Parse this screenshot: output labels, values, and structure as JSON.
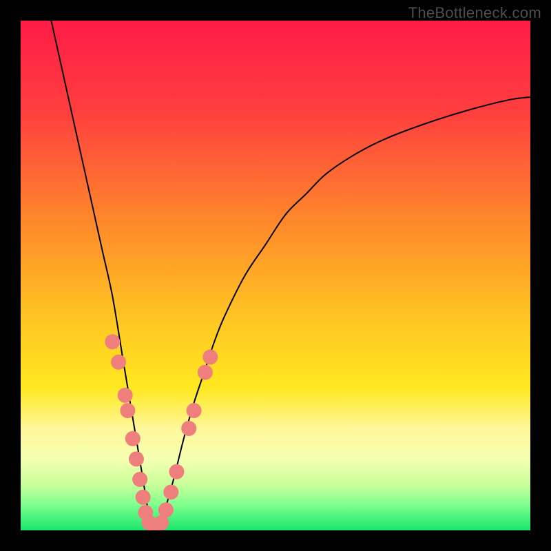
{
  "watermark": "TheBottleneck.com",
  "chart_data": {
    "type": "line",
    "title": "",
    "xlabel": "",
    "ylabel": "",
    "xlim": [
      0,
      100
    ],
    "ylim": [
      0,
      100
    ],
    "background_gradient": {
      "stops": [
        {
          "offset": 0.0,
          "color": "#ff1b46"
        },
        {
          "offset": 0.18,
          "color": "#ff3f3f"
        },
        {
          "offset": 0.4,
          "color": "#ff8a2a"
        },
        {
          "offset": 0.58,
          "color": "#ffc423"
        },
        {
          "offset": 0.72,
          "color": "#ffe81f"
        },
        {
          "offset": 0.8,
          "color": "#fff79a"
        },
        {
          "offset": 0.86,
          "color": "#f6ffb0"
        },
        {
          "offset": 0.91,
          "color": "#c9ff9a"
        },
        {
          "offset": 0.95,
          "color": "#7fff8e"
        },
        {
          "offset": 1.0,
          "color": "#18e76c"
        }
      ]
    },
    "series": [
      {
        "name": "bottleneck-curve",
        "color": "#000000",
        "stroke_width": 2,
        "x": [
          6,
          8,
          10,
          12,
          14,
          16,
          18,
          20,
          21,
          22,
          23,
          24,
          25,
          26,
          27,
          28,
          30,
          32,
          34,
          36,
          38,
          40,
          44,
          48,
          52,
          56,
          60,
          66,
          72,
          80,
          88,
          96,
          100
        ],
        "y": [
          100,
          91,
          82,
          73,
          64,
          55,
          46,
          34,
          28,
          22,
          16,
          10,
          4,
          0,
          0,
          3,
          10,
          18,
          25,
          31,
          37,
          42,
          50,
          56,
          62,
          66,
          70,
          74,
          77,
          80,
          82.5,
          84.5,
          85
        ]
      }
    ],
    "markers": {
      "name": "highlight-points",
      "color": "#ef7f7c",
      "radius": 11,
      "points": [
        {
          "x": 18.0,
          "y": 37.0
        },
        {
          "x": 19.2,
          "y": 33.0
        },
        {
          "x": 20.5,
          "y": 26.5
        },
        {
          "x": 21.0,
          "y": 23.5
        },
        {
          "x": 22.0,
          "y": 18.0
        },
        {
          "x": 22.7,
          "y": 14.0
        },
        {
          "x": 23.4,
          "y": 10.0
        },
        {
          "x": 24.0,
          "y": 6.5
        },
        {
          "x": 24.5,
          "y": 3.5
        },
        {
          "x": 25.2,
          "y": 1.5
        },
        {
          "x": 26.0,
          "y": 0.5
        },
        {
          "x": 26.8,
          "y": 0.5
        },
        {
          "x": 27.6,
          "y": 1.5
        },
        {
          "x": 28.5,
          "y": 4.0
        },
        {
          "x": 29.5,
          "y": 7.5
        },
        {
          "x": 30.6,
          "y": 11.5
        },
        {
          "x": 33.0,
          "y": 20.0
        },
        {
          "x": 34.0,
          "y": 23.5
        },
        {
          "x": 36.2,
          "y": 31.0
        },
        {
          "x": 37.2,
          "y": 34.0
        }
      ]
    }
  }
}
